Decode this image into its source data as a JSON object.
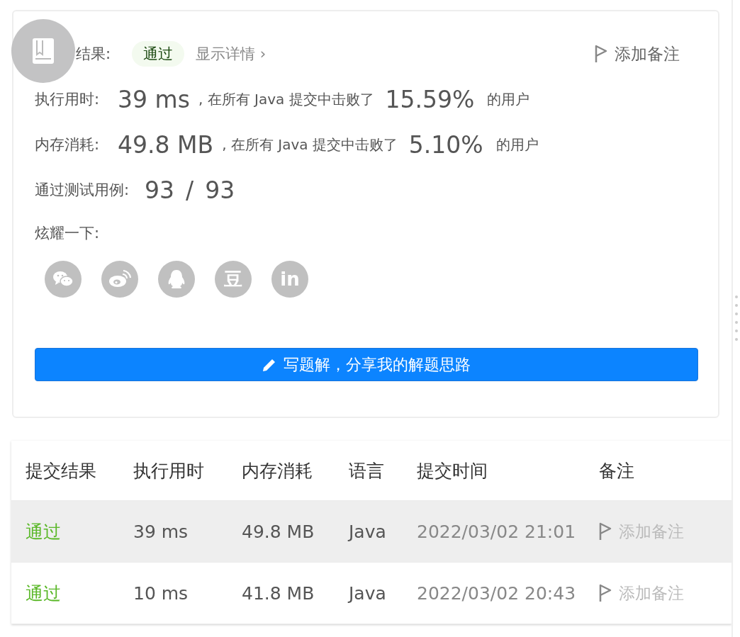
{
  "result": {
    "label": "结果:",
    "status": "通过",
    "details_link": "显示详情",
    "details_arrow": "›",
    "add_note": "添加备注"
  },
  "stats": [
    {
      "label": "执行用时:",
      "value": "39 ms",
      "middle": ", 在所有 Java 提交中击败了",
      "percent": "15.59%",
      "suffix": "的用户"
    },
    {
      "label": "内存消耗:",
      "value": "49.8 MB",
      "middle": ", 在所有 Java 提交中击败了",
      "percent": "5.10%",
      "suffix": "的用户"
    }
  ],
  "test_cases": {
    "label": "通过测试用例:",
    "passed": "93",
    "separator": "/",
    "total": "93"
  },
  "share": {
    "label": "炫耀一下:",
    "icons": [
      {
        "kind": "wechat"
      },
      {
        "kind": "weibo"
      },
      {
        "kind": "qq"
      },
      {
        "kind": "glyph",
        "text": "豆"
      },
      {
        "kind": "glyph",
        "text": "in"
      }
    ]
  },
  "write_button": "写题解，分享我的解题思路",
  "table": {
    "columns": [
      "提交结果",
      "执行用时",
      "内存消耗",
      "语言",
      "提交时间",
      "备注"
    ],
    "rows": [
      {
        "result": "通过",
        "time": "39 ms",
        "memory": "49.8 MB",
        "language": "Java",
        "submitted": "2022/03/02 21:01",
        "note": "添加备注",
        "highlighted": true
      },
      {
        "result": "通过",
        "time": "10 ms",
        "memory": "41.8 MB",
        "language": "Java",
        "submitted": "2022/03/02 20:43",
        "note": "添加备注",
        "highlighted": false
      }
    ]
  }
}
